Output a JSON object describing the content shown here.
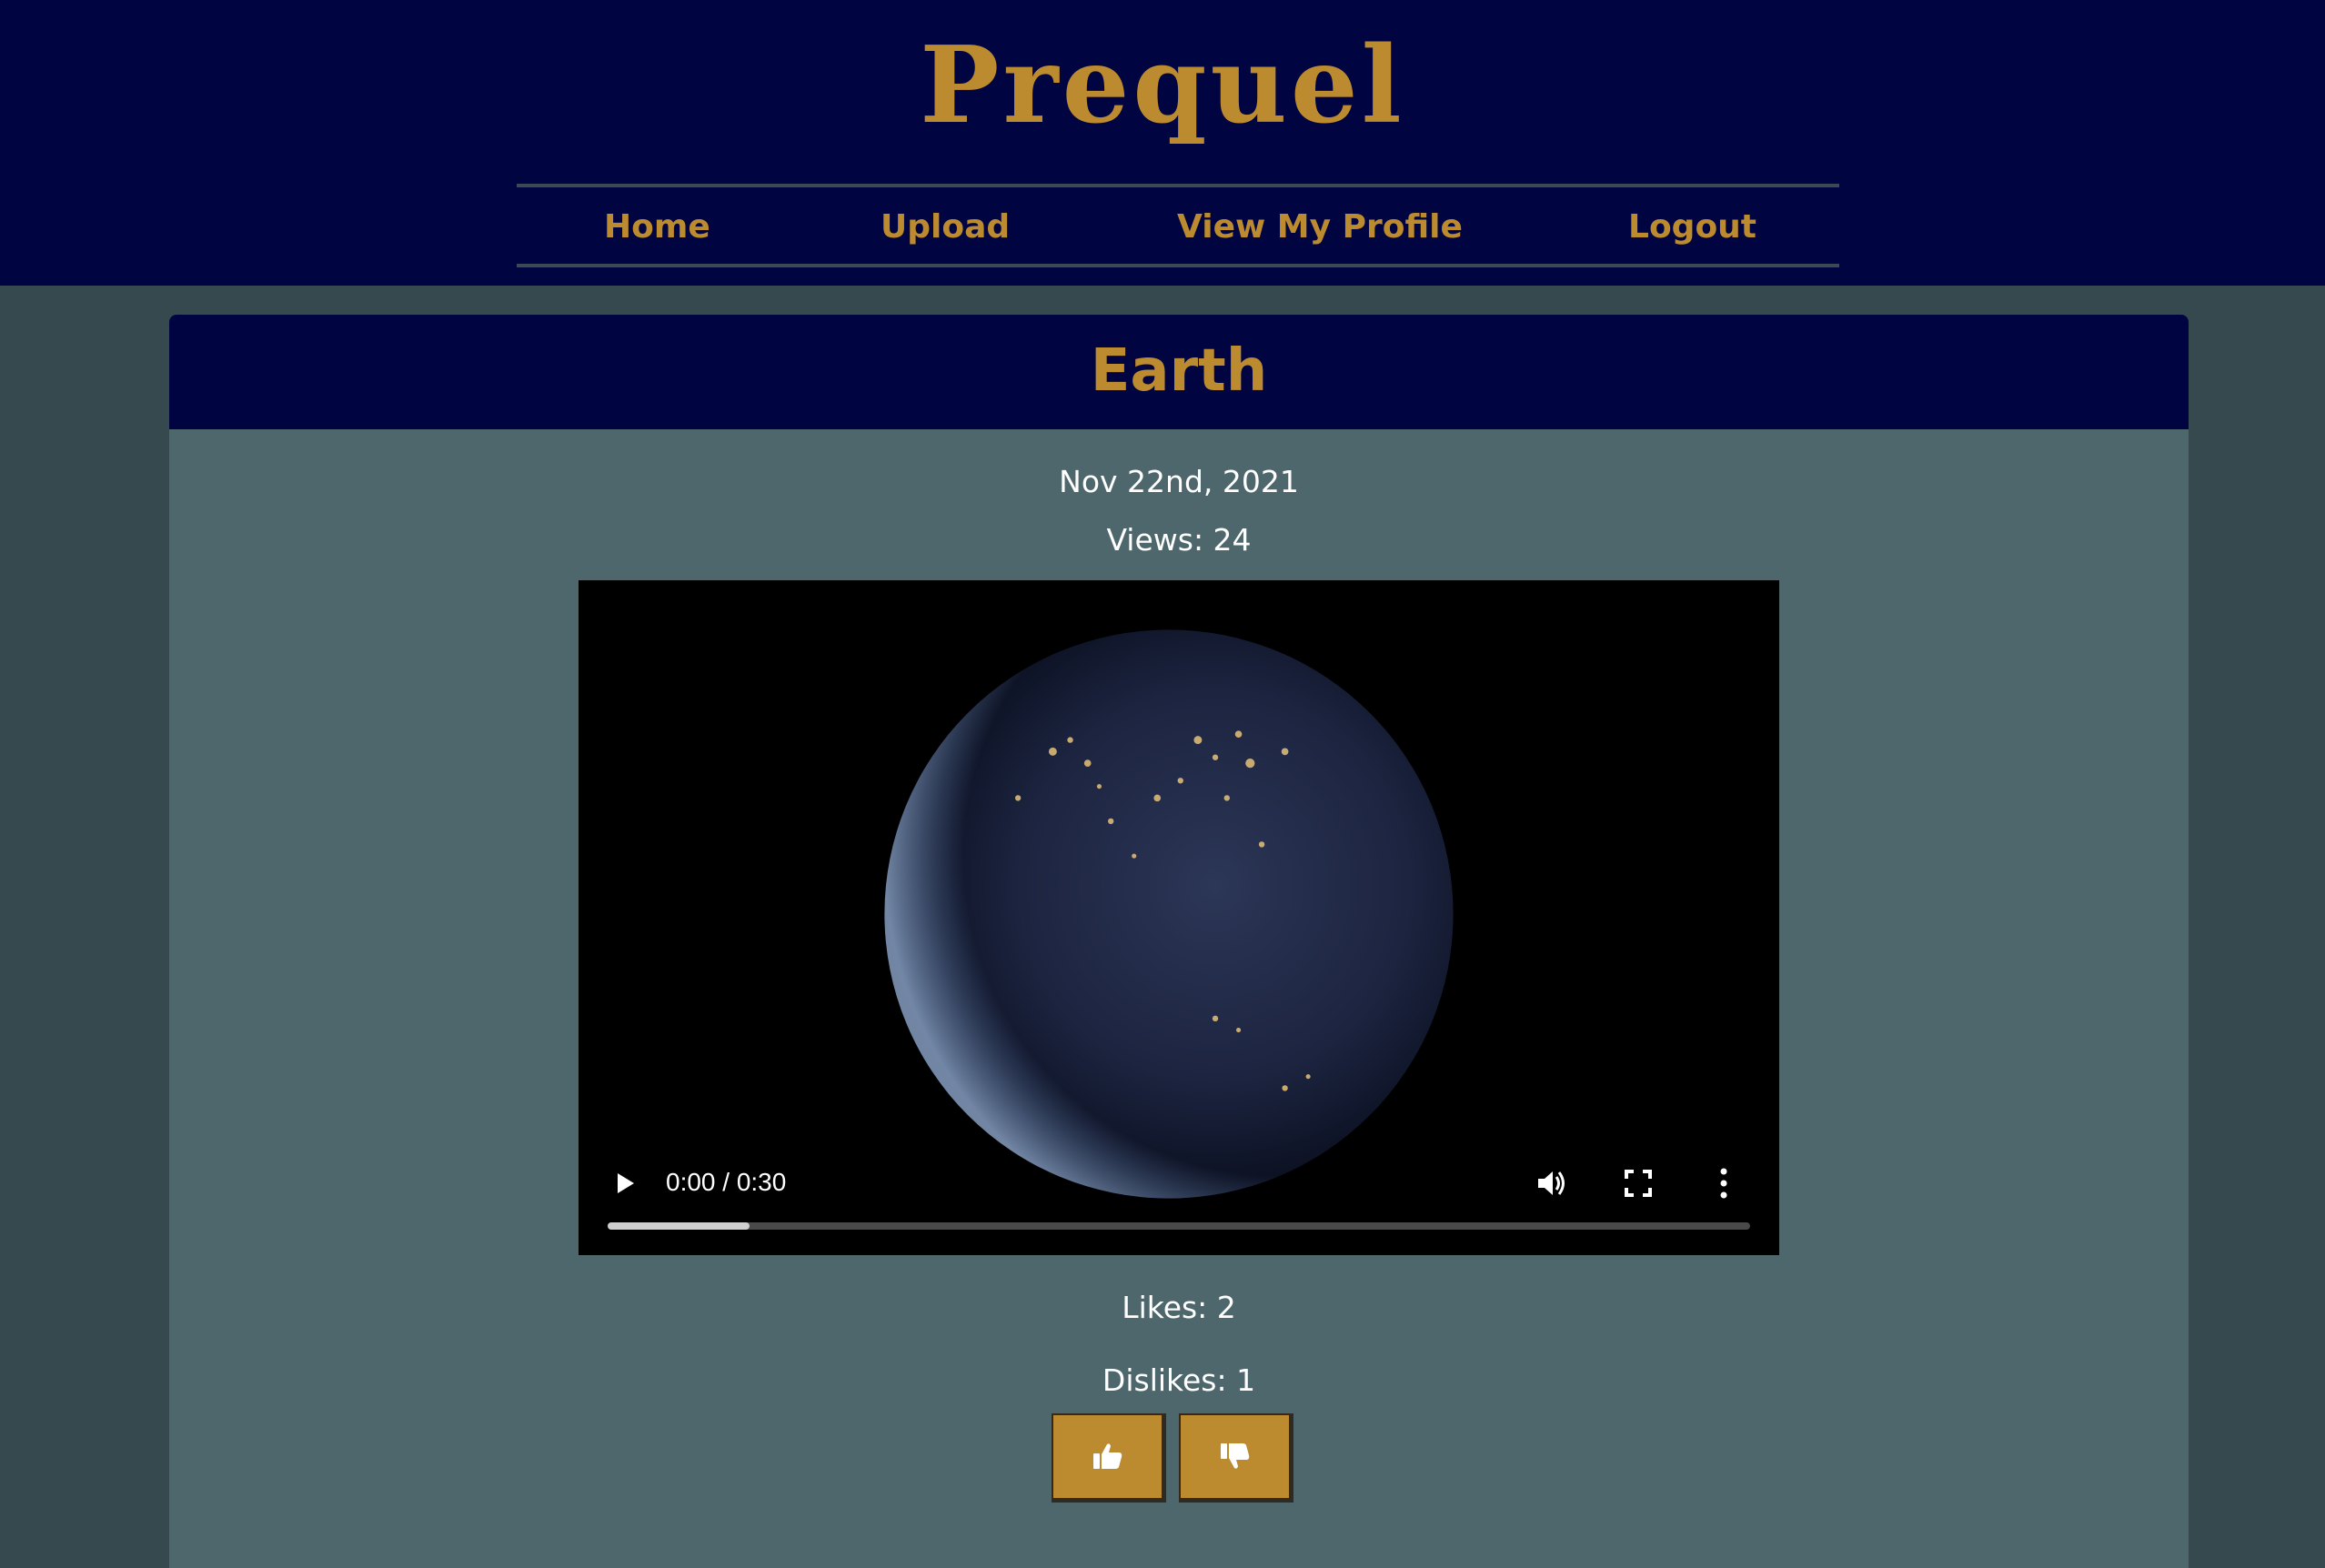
{
  "header": {
    "logo": "Prequel",
    "nav": [
      {
        "label": "Home"
      },
      {
        "label": "Upload"
      },
      {
        "label": "View My Profile"
      },
      {
        "label": "Logout"
      }
    ]
  },
  "post": {
    "title": "Earth",
    "date": "Nov 22nd, 2021",
    "views_text": "Views: 24",
    "likes_text": "Likes: 2",
    "dislikes_text": "Dislikes: 1"
  },
  "video": {
    "time": "0:00 / 0:30",
    "buffered_fraction": 0.124,
    "icons": {
      "play": "play-icon",
      "volume": "volume-icon",
      "fullscreen": "fullscreen-icon",
      "more": "more-vertical-icon"
    }
  },
  "buttons": {
    "like": "thumbs-up-icon",
    "dislike": "thumbs-down-icon"
  },
  "colors": {
    "navy": "#000441",
    "gold": "#bc8a2f",
    "page_bg": "#36494f",
    "card_bg": "#4e676d"
  }
}
